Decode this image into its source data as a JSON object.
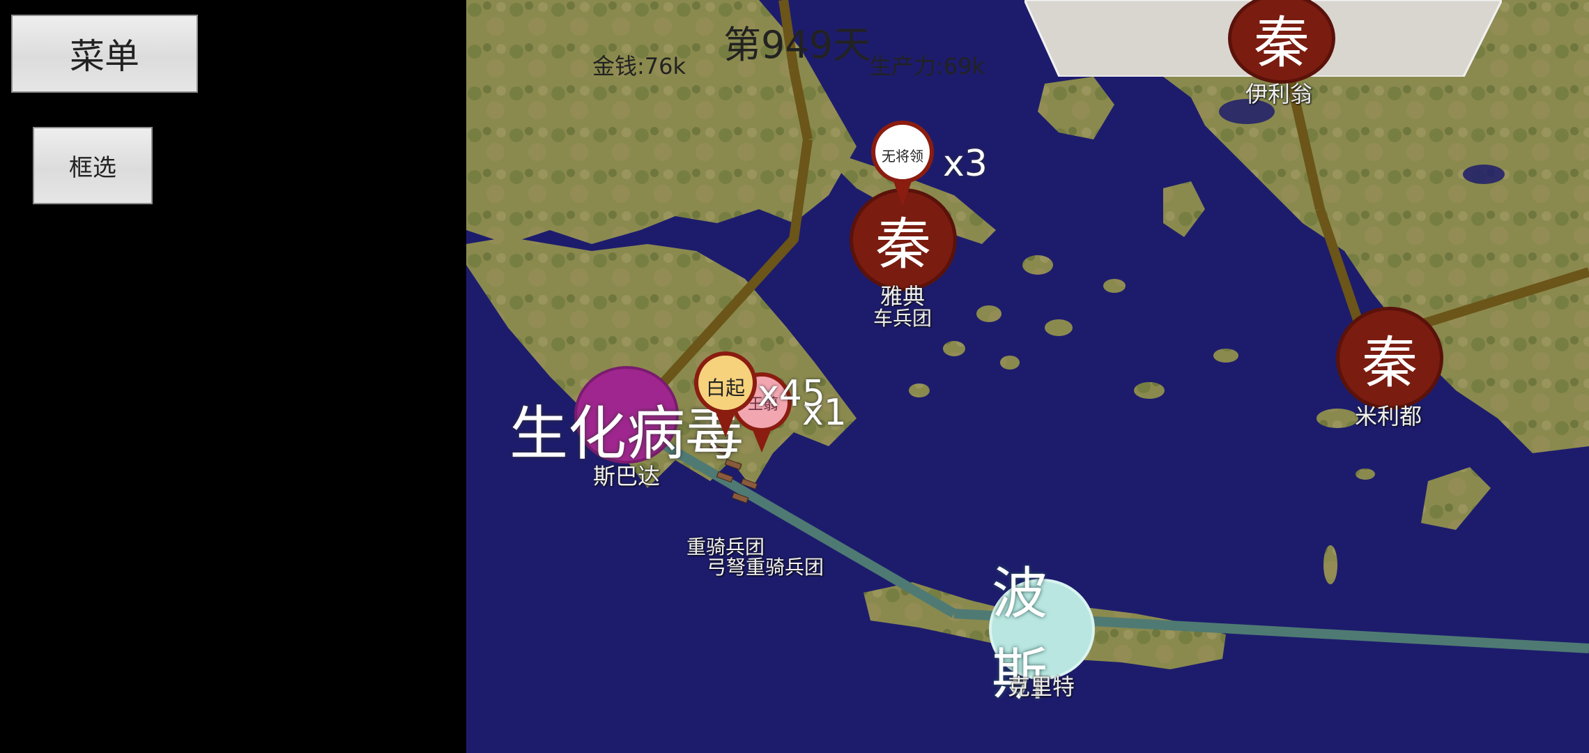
{
  "sidebar": {
    "menu_label": "菜单",
    "select_label": "框选"
  },
  "status": {
    "day": "第949天",
    "money": "金钱:76k",
    "production": "生产力:69k"
  },
  "colors": {
    "qin": "#7a1c10",
    "plague": "#a0268f",
    "persia": "#b9e6e0",
    "route_land": "#6b5518",
    "route_sea": "#4f7a73",
    "sea": "#1d1c6c"
  },
  "cities": [
    {
      "faction": "秦",
      "name": "伊利翁",
      "sub": ""
    },
    {
      "faction": "秦",
      "name": "雅典",
      "sub": "车兵团"
    },
    {
      "faction": "秦",
      "name": "米利都",
      "sub": ""
    },
    {
      "faction": "生化病毒",
      "name": "斯巴达",
      "sub": ""
    },
    {
      "faction": "波斯",
      "name": "克里特",
      "sub": ""
    }
  ],
  "armies": [
    {
      "general": "无将领",
      "count": "x3"
    },
    {
      "general": "白起",
      "count": "x45"
    },
    {
      "general": "王翦",
      "count": "x1"
    }
  ],
  "unit_labels": [
    "重骑兵团",
    "弓弩重骑兵团"
  ]
}
